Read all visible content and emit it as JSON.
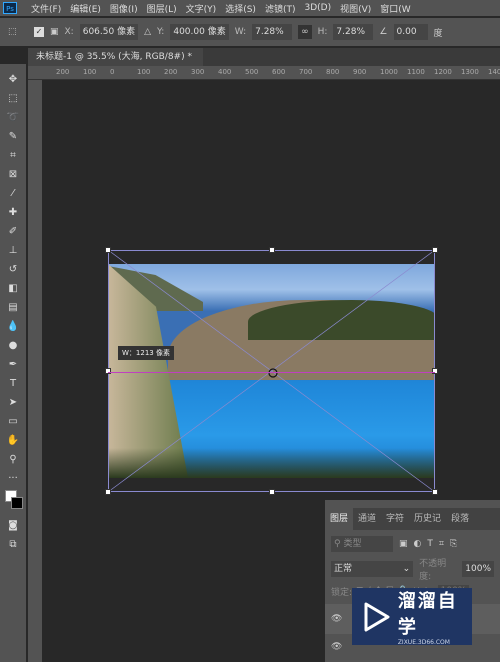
{
  "app": {
    "logo": "Ps",
    "menu": [
      "文件(F)",
      "编辑(E)",
      "图像(I)",
      "图层(L)",
      "文字(Y)",
      "选择(S)",
      "滤镜(T)",
      "3D(D)",
      "视图(V)",
      "窗口(W"
    ]
  },
  "options": {
    "x_label": "X:",
    "x_value": "606.50 像素",
    "y_label": "Y:",
    "y_value": "400.00 像素",
    "w_label": "W:",
    "w_value": "7.28%",
    "h_label": "H:",
    "h_value": "7.28%",
    "angle_value": "0.00",
    "angle_unit": "度"
  },
  "document": {
    "tab_title": "未标题-1 @ 35.5% (大海, RGB/8#) *",
    "close": "×"
  },
  "ruler": {
    "ticks": [
      "200",
      "100",
      "0",
      "100",
      "200",
      "300",
      "400",
      "500",
      "600",
      "700",
      "800",
      "900",
      "1000",
      "1100",
      "1200",
      "1300",
      "1400"
    ]
  },
  "canvas": {
    "tooltip": "W：1213 像素"
  },
  "layers_panel": {
    "tabs": [
      "图层",
      "通道",
      "字符",
      "历史记",
      "段落"
    ],
    "search_placeholder": "类型",
    "blend_mode": "正常",
    "opacity_label": "不透明度:",
    "opacity_value": "100%",
    "lock_label": "锁定:",
    "fill_label": "填充:",
    "fill_value": "100%"
  },
  "watermark": {
    "name": "溜溜自学",
    "url": "ZIXUE.3D66.COM"
  }
}
